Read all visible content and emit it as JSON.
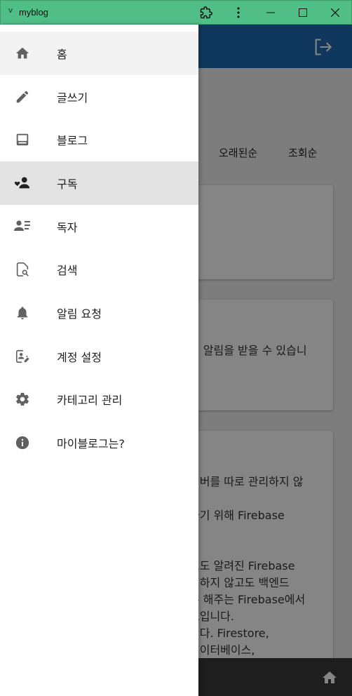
{
  "window": {
    "title": "myblog"
  },
  "sort": {
    "oldest": "오래된순",
    "views": "조회순"
  },
  "background": {
    "card2_line": "시 알림을 받을 수 있습니",
    "card3_lines": [
      "서버를 따로 관리하지 않",
      "",
      "하기 위해 Firebase",
      "",
      "",
      "고도 알려진 Firebase",
      "리하지 않고도 백엔드",
      "록 해주는 Firebase에서",
      "스입니다.",
      "니다. Firestore,",
      "데이터베이스,"
    ]
  },
  "menu": [
    {
      "label": "홈",
      "icon": "home-icon"
    },
    {
      "label": "글쓰기",
      "icon": "pencil-icon"
    },
    {
      "label": "블로그",
      "icon": "blog-icon"
    },
    {
      "label": "구독",
      "icon": "subscribe-icon"
    },
    {
      "label": "독자",
      "icon": "readers-icon"
    },
    {
      "label": "검색",
      "icon": "search-icon"
    },
    {
      "label": "알림 요청",
      "icon": "bell-icon"
    },
    {
      "label": "계정 설정",
      "icon": "account-settings-icon"
    },
    {
      "label": "카테고리 관리",
      "icon": "gear-icon"
    },
    {
      "label": "마이블로그는?",
      "icon": "info-icon"
    }
  ],
  "colors": {
    "titlebar": "#4fbf87",
    "appbar": "#1f6bb4",
    "selected": "#e3e3e3"
  }
}
